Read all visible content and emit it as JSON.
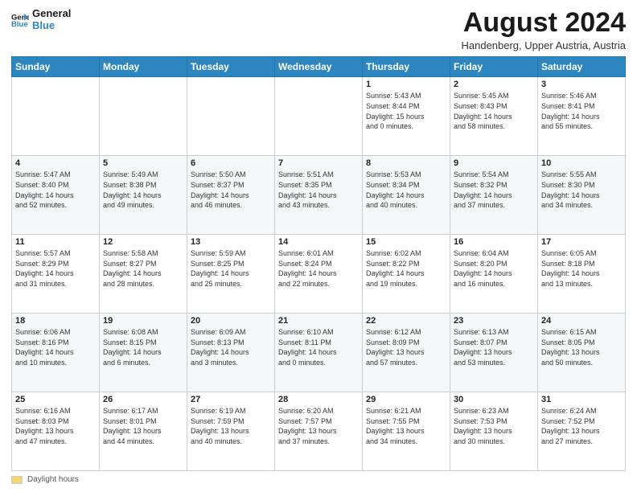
{
  "header": {
    "logo_line1": "General",
    "logo_line2": "Blue",
    "month_year": "August 2024",
    "location": "Handenberg, Upper Austria, Austria"
  },
  "days_of_week": [
    "Sunday",
    "Monday",
    "Tuesday",
    "Wednesday",
    "Thursday",
    "Friday",
    "Saturday"
  ],
  "weeks": [
    [
      {
        "num": "",
        "info": ""
      },
      {
        "num": "",
        "info": ""
      },
      {
        "num": "",
        "info": ""
      },
      {
        "num": "",
        "info": ""
      },
      {
        "num": "1",
        "info": "Sunrise: 5:43 AM\nSunset: 8:44 PM\nDaylight: 15 hours\nand 0 minutes."
      },
      {
        "num": "2",
        "info": "Sunrise: 5:45 AM\nSunset: 8:43 PM\nDaylight: 14 hours\nand 58 minutes."
      },
      {
        "num": "3",
        "info": "Sunrise: 5:46 AM\nSunset: 8:41 PM\nDaylight: 14 hours\nand 55 minutes."
      }
    ],
    [
      {
        "num": "4",
        "info": "Sunrise: 5:47 AM\nSunset: 8:40 PM\nDaylight: 14 hours\nand 52 minutes."
      },
      {
        "num": "5",
        "info": "Sunrise: 5:49 AM\nSunset: 8:38 PM\nDaylight: 14 hours\nand 49 minutes."
      },
      {
        "num": "6",
        "info": "Sunrise: 5:50 AM\nSunset: 8:37 PM\nDaylight: 14 hours\nand 46 minutes."
      },
      {
        "num": "7",
        "info": "Sunrise: 5:51 AM\nSunset: 8:35 PM\nDaylight: 14 hours\nand 43 minutes."
      },
      {
        "num": "8",
        "info": "Sunrise: 5:53 AM\nSunset: 8:34 PM\nDaylight: 14 hours\nand 40 minutes."
      },
      {
        "num": "9",
        "info": "Sunrise: 5:54 AM\nSunset: 8:32 PM\nDaylight: 14 hours\nand 37 minutes."
      },
      {
        "num": "10",
        "info": "Sunrise: 5:55 AM\nSunset: 8:30 PM\nDaylight: 14 hours\nand 34 minutes."
      }
    ],
    [
      {
        "num": "11",
        "info": "Sunrise: 5:57 AM\nSunset: 8:29 PM\nDaylight: 14 hours\nand 31 minutes."
      },
      {
        "num": "12",
        "info": "Sunrise: 5:58 AM\nSunset: 8:27 PM\nDaylight: 14 hours\nand 28 minutes."
      },
      {
        "num": "13",
        "info": "Sunrise: 5:59 AM\nSunset: 8:25 PM\nDaylight: 14 hours\nand 25 minutes."
      },
      {
        "num": "14",
        "info": "Sunrise: 6:01 AM\nSunset: 8:24 PM\nDaylight: 14 hours\nand 22 minutes."
      },
      {
        "num": "15",
        "info": "Sunrise: 6:02 AM\nSunset: 8:22 PM\nDaylight: 14 hours\nand 19 minutes."
      },
      {
        "num": "16",
        "info": "Sunrise: 6:04 AM\nSunset: 8:20 PM\nDaylight: 14 hours\nand 16 minutes."
      },
      {
        "num": "17",
        "info": "Sunrise: 6:05 AM\nSunset: 8:18 PM\nDaylight: 14 hours\nand 13 minutes."
      }
    ],
    [
      {
        "num": "18",
        "info": "Sunrise: 6:06 AM\nSunset: 8:16 PM\nDaylight: 14 hours\nand 10 minutes."
      },
      {
        "num": "19",
        "info": "Sunrise: 6:08 AM\nSunset: 8:15 PM\nDaylight: 14 hours\nand 6 minutes."
      },
      {
        "num": "20",
        "info": "Sunrise: 6:09 AM\nSunset: 8:13 PM\nDaylight: 14 hours\nand 3 minutes."
      },
      {
        "num": "21",
        "info": "Sunrise: 6:10 AM\nSunset: 8:11 PM\nDaylight: 14 hours\nand 0 minutes."
      },
      {
        "num": "22",
        "info": "Sunrise: 6:12 AM\nSunset: 8:09 PM\nDaylight: 13 hours\nand 57 minutes."
      },
      {
        "num": "23",
        "info": "Sunrise: 6:13 AM\nSunset: 8:07 PM\nDaylight: 13 hours\nand 53 minutes."
      },
      {
        "num": "24",
        "info": "Sunrise: 6:15 AM\nSunset: 8:05 PM\nDaylight: 13 hours\nand 50 minutes."
      }
    ],
    [
      {
        "num": "25",
        "info": "Sunrise: 6:16 AM\nSunset: 8:03 PM\nDaylight: 13 hours\nand 47 minutes."
      },
      {
        "num": "26",
        "info": "Sunrise: 6:17 AM\nSunset: 8:01 PM\nDaylight: 13 hours\nand 44 minutes."
      },
      {
        "num": "27",
        "info": "Sunrise: 6:19 AM\nSunset: 7:59 PM\nDaylight: 13 hours\nand 40 minutes."
      },
      {
        "num": "28",
        "info": "Sunrise: 6:20 AM\nSunset: 7:57 PM\nDaylight: 13 hours\nand 37 minutes."
      },
      {
        "num": "29",
        "info": "Sunrise: 6:21 AM\nSunset: 7:55 PM\nDaylight: 13 hours\nand 34 minutes."
      },
      {
        "num": "30",
        "info": "Sunrise: 6:23 AM\nSunset: 7:53 PM\nDaylight: 13 hours\nand 30 minutes."
      },
      {
        "num": "31",
        "info": "Sunrise: 6:24 AM\nSunset: 7:52 PM\nDaylight: 13 hours\nand 27 minutes."
      }
    ]
  ],
  "footer": {
    "legend_label": "Daylight hours"
  }
}
